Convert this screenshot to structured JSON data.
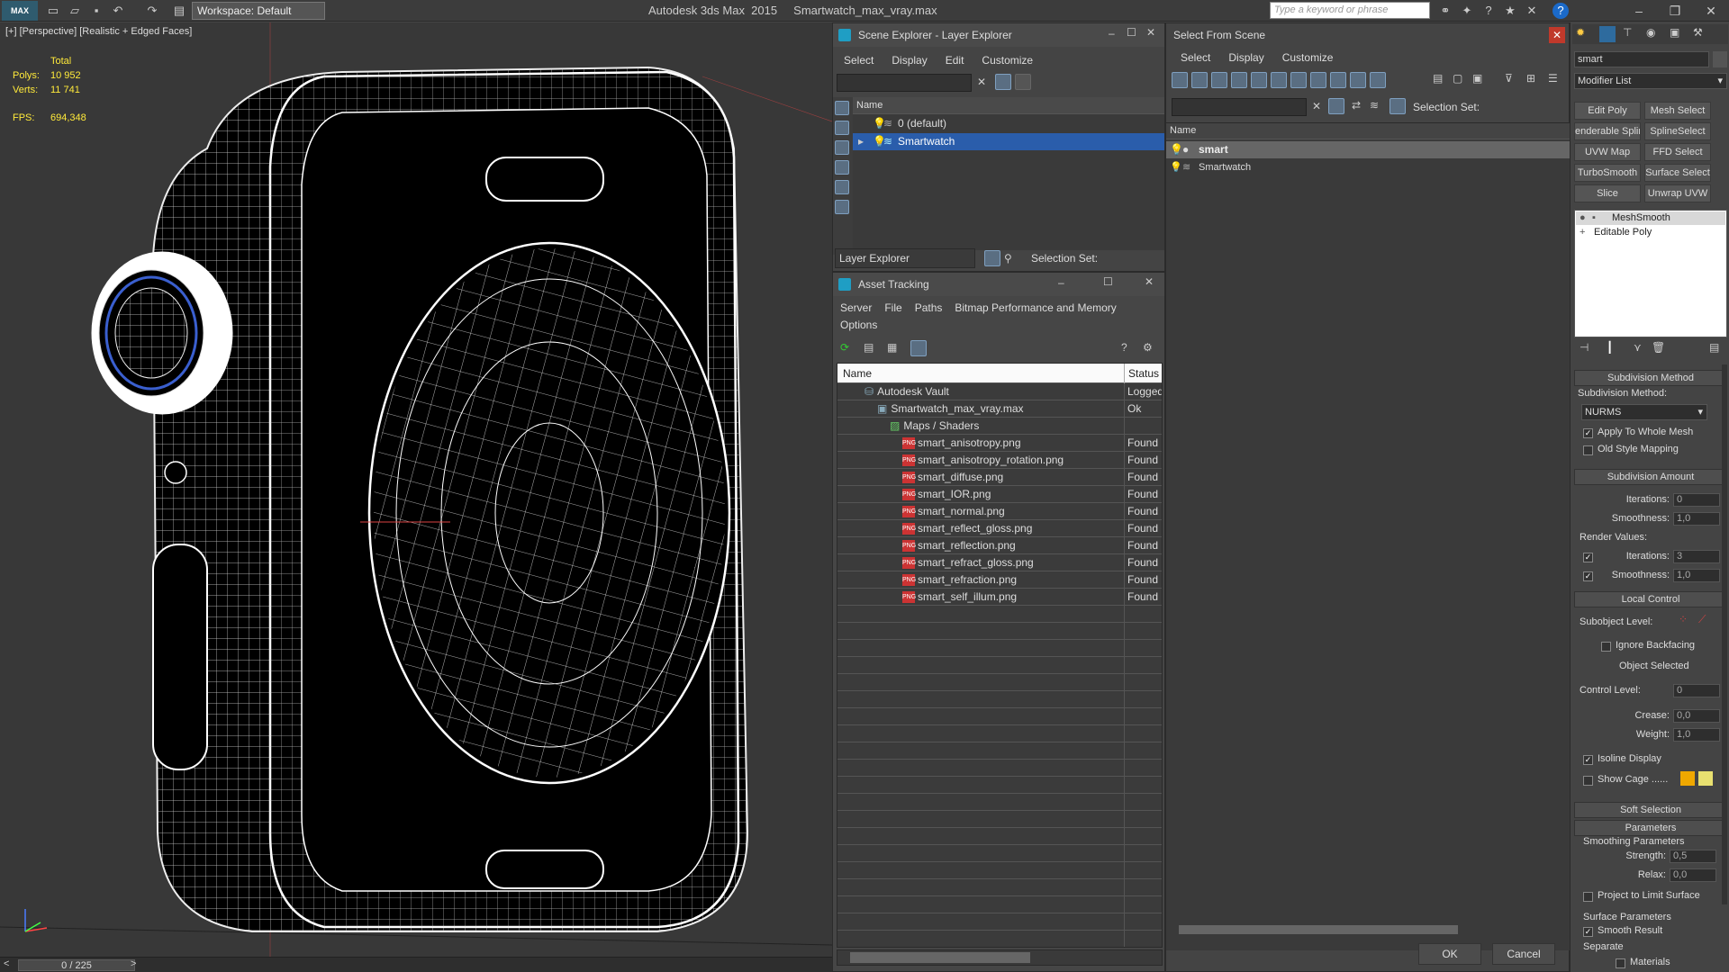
{
  "app": {
    "title": "Autodesk 3ds Max  2015     Smartwatch_max_vray.max",
    "logo": "MAX",
    "workspace": "Workspace: Default",
    "search_placeholder": "Type a keyword or phrase"
  },
  "viewport": {
    "label": "[+] [Perspective] [Realistic + Edged Faces]",
    "stats": {
      "total_label": "Total",
      "polys_label": "Polys:",
      "polys_value": "10 952",
      "verts_label": "Verts:",
      "verts_value": "11 741",
      "fps_label": "FPS:",
      "fps_value": "694,348"
    },
    "timeline": "0 / 225"
  },
  "scene_explorer": {
    "title": "Scene Explorer - Layer Explorer",
    "menu": [
      "Select",
      "Display",
      "Edit",
      "Customize"
    ],
    "column": "Name",
    "rows": [
      "0 (default)",
      "Smartwatch"
    ],
    "footer_mode": "Layer Explorer",
    "selection_set_label": "Selection Set:"
  },
  "asset_tracking": {
    "title": "Asset Tracking",
    "menu": [
      "Server",
      "File",
      "Paths",
      "Bitmap Performance and Memory"
    ],
    "menu2": "Options",
    "col_name": "Name",
    "col_status": "Status",
    "rows": [
      {
        "name": "Autodesk Vault",
        "status": "Logged"
      },
      {
        "name": "Smartwatch_max_vray.max",
        "status": "Ok"
      },
      {
        "name": "Maps / Shaders",
        "status": ""
      },
      {
        "name": "smart_anisotropy.png",
        "status": "Found"
      },
      {
        "name": "smart_anisotropy_rotation.png",
        "status": "Found"
      },
      {
        "name": "smart_diffuse.png",
        "status": "Found"
      },
      {
        "name": "smart_IOR.png",
        "status": "Found"
      },
      {
        "name": "smart_normal.png",
        "status": "Found"
      },
      {
        "name": "smart_reflect_gloss.png",
        "status": "Found"
      },
      {
        "name": "smart_reflection.png",
        "status": "Found"
      },
      {
        "name": "smart_refract_gloss.png",
        "status": "Found"
      },
      {
        "name": "smart_refraction.png",
        "status": "Found"
      },
      {
        "name": "smart_self_illum.png",
        "status": "Found"
      }
    ],
    "png_badge": "PNG"
  },
  "select_from_scene": {
    "title": "Select From Scene",
    "menu": [
      "Select",
      "Display",
      "Customize"
    ],
    "selection_set_label": "Selection Set:",
    "column": "Name",
    "rows": [
      "smart",
      "Smartwatch"
    ],
    "ok": "OK",
    "cancel": "Cancel"
  },
  "command_panel": {
    "object_name": "smart",
    "modifier_list": "Modifier List",
    "mod_buttons": [
      "Edit Poly",
      "Mesh Select",
      "enderable Splir",
      "SplineSelect",
      "UVW Map",
      "FFD Select",
      "TurboSmooth",
      "Surface Select",
      "Slice",
      "Unwrap UVW"
    ],
    "stack": [
      "MeshSmooth",
      "Editable Poly"
    ],
    "subdivision_method_header": "Subdivision Method",
    "subdivision_method_label": "Subdivision Method:",
    "subdivision_method_value": "NURMS",
    "apply_whole_mesh": "Apply To Whole Mesh",
    "old_style_mapping": "Old Style Mapping",
    "subdivision_amount_header": "Subdivision Amount",
    "iterations_label": "Iterations:",
    "iterations_value": "0",
    "smoothness_label": "Smoothness:",
    "smoothness_value": "1,0",
    "render_values_label": "Render Values:",
    "r_iterations_label": "Iterations:",
    "r_iterations_value": "3",
    "r_smoothness_label": "Smoothness:",
    "r_smoothness_value": "1,0",
    "local_control_header": "Local Control",
    "subobject_label": "Subobject Level:",
    "ignore_backfacing": "Ignore Backfacing",
    "object_selected": "Object Selected",
    "control_level_label": "Control Level:",
    "control_level_value": "0",
    "crease_label": "Crease:",
    "crease_value": "0,0",
    "weight_label": "Weight:",
    "weight_value": "1,0",
    "isoline_display": "Isoline Display",
    "show_cage": "Show Cage ......",
    "soft_selection_header": "Soft Selection",
    "parameters_header": "Parameters",
    "smoothing_params_label": "Smoothing Parameters",
    "strength_label": "Strength:",
    "strength_value": "0,5",
    "relax_label": "Relax:",
    "relax_value": "0,0",
    "project_limit": "Project to Limit Surface",
    "surface_params_label": "Surface Parameters",
    "smooth_result": "Smooth Result",
    "separate_label": "Separate",
    "materials_label": "Materials"
  },
  "colors": {
    "selection_blue": "#2a5dab",
    "stats_yellow": "#ffea3a",
    "cage_orange": "#f0a800",
    "cage_yellow": "#e8e070"
  }
}
